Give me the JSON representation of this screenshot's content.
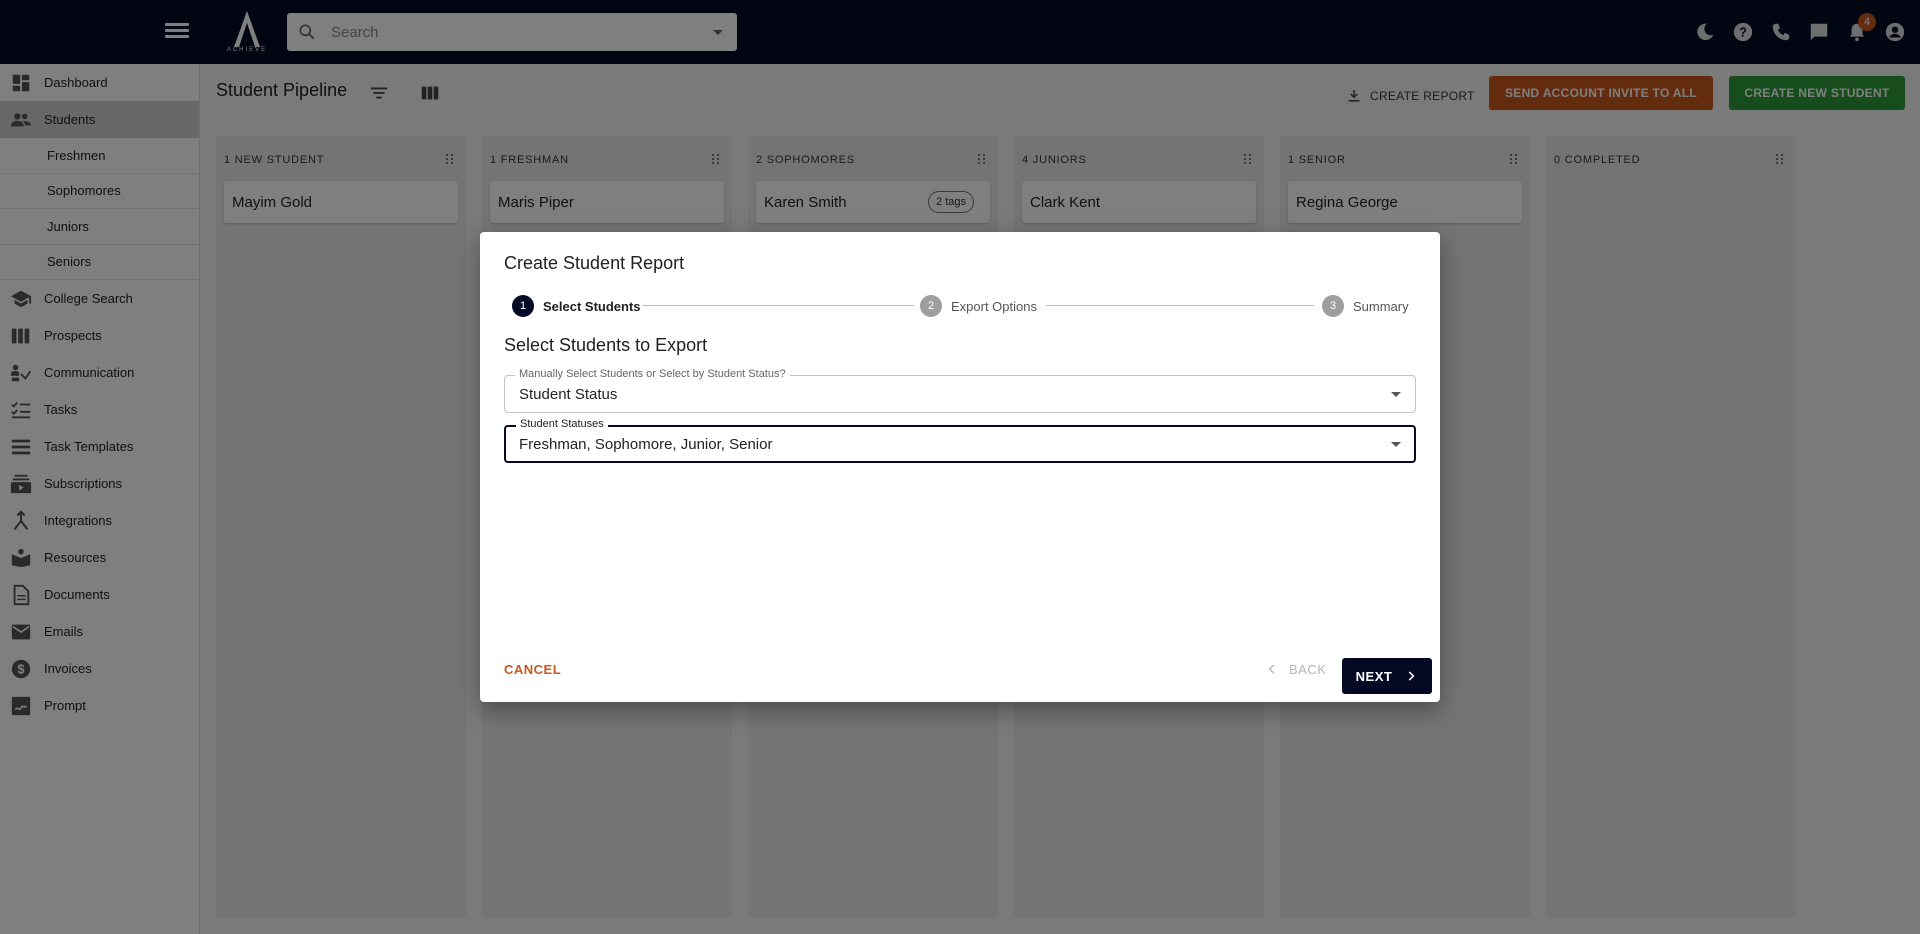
{
  "topbar": {
    "logo_text": "ACHIEVE",
    "search_placeholder": "Search",
    "notification_count": "4"
  },
  "sidebar": {
    "items": [
      {
        "label": "Dashboard",
        "icon": "dashboard-icon"
      },
      {
        "label": "Students",
        "icon": "students-icon",
        "active": true
      },
      {
        "label": "College Search",
        "icon": "school-icon"
      },
      {
        "label": "Prospects",
        "icon": "prospects-icon"
      },
      {
        "label": "Communication",
        "icon": "communication-icon"
      },
      {
        "label": "Tasks",
        "icon": "tasks-icon"
      },
      {
        "label": "Task Templates",
        "icon": "task-templates-icon"
      },
      {
        "label": "Subscriptions",
        "icon": "subscriptions-icon"
      },
      {
        "label": "Integrations",
        "icon": "integrations-icon"
      },
      {
        "label": "Resources",
        "icon": "resources-icon"
      },
      {
        "label": "Documents",
        "icon": "documents-icon"
      },
      {
        "label": "Emails",
        "icon": "email-icon"
      },
      {
        "label": "Invoices",
        "icon": "invoice-icon"
      },
      {
        "label": "Prompt",
        "icon": "prompt-icon"
      }
    ],
    "student_subitems": [
      "Freshmen",
      "Sophomores",
      "Juniors",
      "Seniors"
    ]
  },
  "main": {
    "title": "Student Pipeline",
    "create_report_label": "CREATE REPORT",
    "invite_label": "SEND ACCOUNT INVITE TO ALL",
    "create_student_label": "CREATE NEW STUDENT",
    "columns": [
      {
        "header": "1 NEW STUDENT",
        "cards": [
          {
            "name": "Mayim Gold",
            "tag": ""
          }
        ]
      },
      {
        "header": "1 FRESHMAN",
        "cards": [
          {
            "name": "Maris Piper",
            "tag": ""
          }
        ]
      },
      {
        "header": "2 SOPHOMORES",
        "cards": [
          {
            "name": "Karen Smith",
            "tag": "2 tags"
          }
        ]
      },
      {
        "header": "4 JUNIORS",
        "cards": [
          {
            "name": "Clark Kent",
            "tag": ""
          }
        ]
      },
      {
        "header": "1 SENIOR",
        "cards": [
          {
            "name": "Regina George",
            "tag": ""
          }
        ]
      },
      {
        "header": "0 COMPLETED",
        "cards": []
      }
    ]
  },
  "dialog": {
    "title": "Create Student Report",
    "steps": [
      {
        "number": "1",
        "label": "Select Students",
        "active": true
      },
      {
        "number": "2",
        "label": "Export Options",
        "active": false
      },
      {
        "number": "3",
        "label": "Summary",
        "active": false
      }
    ],
    "section_title": "Select Students to Export",
    "selection_mode": {
      "label": "Manually Select Students or Select by Student Status?",
      "value": "Student Status"
    },
    "student_statuses": {
      "label": "Student Statuses",
      "value": "Freshman, Sophomore, Junior, Senior"
    },
    "cancel_label": "CANCEL",
    "back_label": "BACK",
    "next_label": "NEXT"
  },
  "colors": {
    "topbar": "#050a24",
    "accent_orange": "#c9581c",
    "accent_green": "#2f9a3b",
    "primary_dark": "#050a24"
  }
}
